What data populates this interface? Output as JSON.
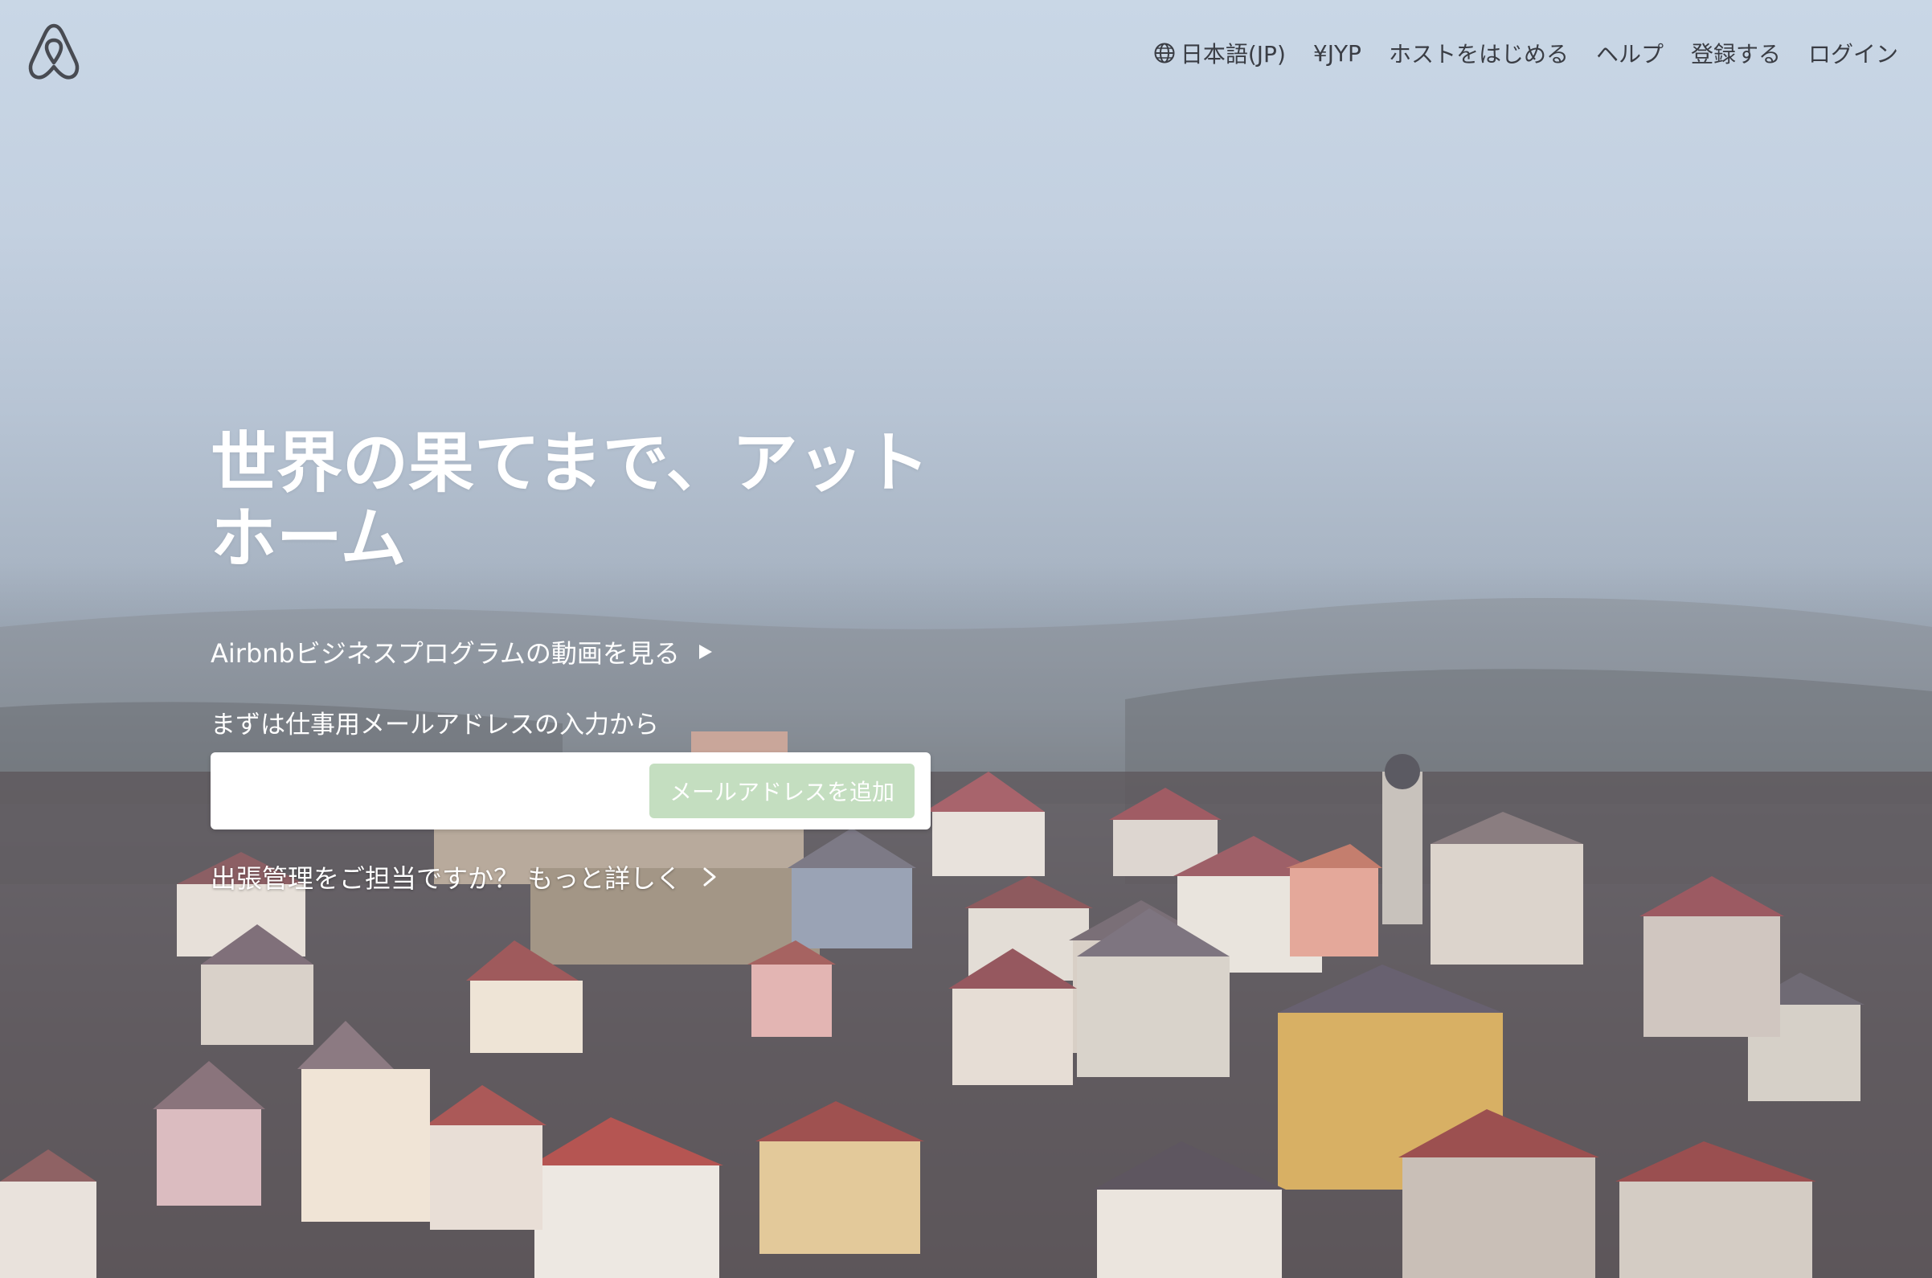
{
  "header": {
    "logo_icon": "airbnb-belo-icon",
    "nav": [
      {
        "label": "日本語(JP)",
        "icon": "globe-icon"
      },
      {
        "label": "¥JYP"
      },
      {
        "label": "ホストをはじめる"
      },
      {
        "label": "ヘルプ"
      },
      {
        "label": "登録する"
      },
      {
        "label": "ログイン"
      }
    ]
  },
  "hero": {
    "title": "世界の果てまで、アットホーム",
    "video_link": "Airbnbビジネスプログラムの動画を見る",
    "video_icon": "play-icon",
    "email_label": "まずは仕事用メールアドレスの入力から",
    "email_value": "",
    "email_button": "メールアドレスを追加",
    "more_link": "出張管理をご担当ですか？ もっと詳しく",
    "more_icon": "chevron-right-icon"
  },
  "colors": {
    "button_bg": "#c4dec0",
    "text_light": "#ffffff",
    "nav_text": "#3a3d44"
  }
}
